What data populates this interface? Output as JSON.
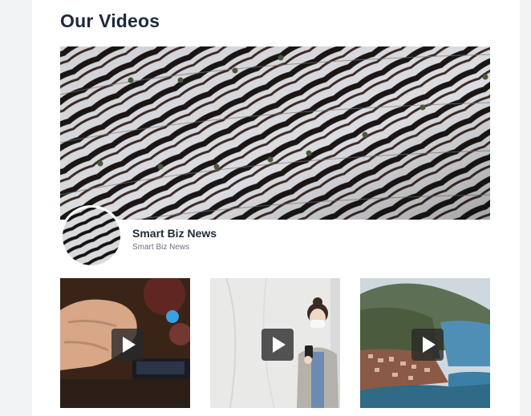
{
  "page": {
    "title": "Our Videos"
  },
  "channel": {
    "name": "Smart Biz News",
    "handle": "Smart Biz News"
  },
  "videos": [
    {
      "icon": "play-icon"
    },
    {
      "icon": "play-icon"
    },
    {
      "icon": "play-icon"
    }
  ],
  "colors": {
    "heading": "#1e2a3b",
    "muted": "#6b7280",
    "play_overlay": "#282828"
  }
}
